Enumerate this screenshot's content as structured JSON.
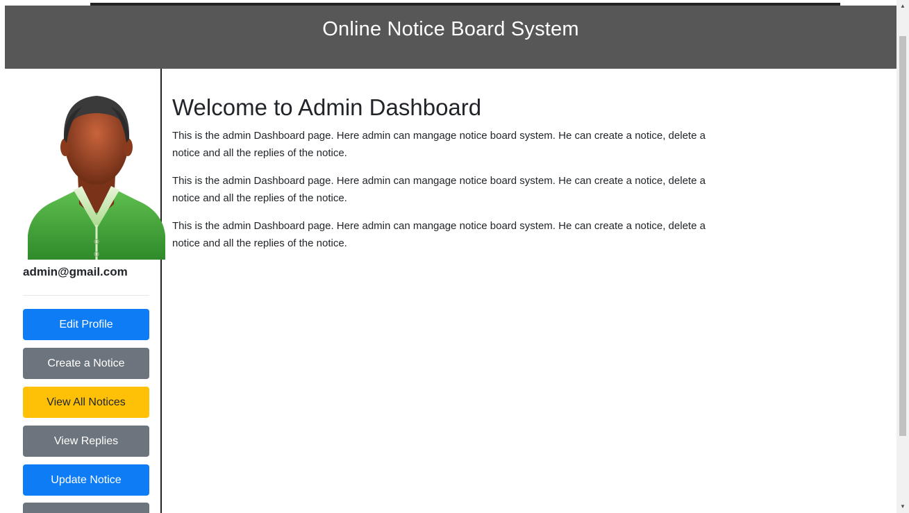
{
  "header": {
    "title": "Online Notice Board System"
  },
  "sidebar": {
    "avatar_icon": "admin-avatar-icon",
    "email": "admin@gmail.com",
    "buttons": [
      {
        "label": "Edit Profile",
        "style": "primary",
        "color": "#0d7cf5"
      },
      {
        "label": "Create a Notice",
        "style": "secondary",
        "color": "#6c757d"
      },
      {
        "label": "View All Notices",
        "style": "warning",
        "color": "#ffc107"
      },
      {
        "label": "View Replies",
        "style": "secondary",
        "color": "#6c757d"
      },
      {
        "label": "Update Notice",
        "style": "primary",
        "color": "#0d7cf5"
      },
      {
        "label": "",
        "style": "secondary",
        "color": "#6c757d"
      }
    ]
  },
  "main": {
    "heading": "Welcome to Admin Dashboard",
    "paragraphs": [
      "This is the admin Dashboard page. Here admin can mangage notice board system. He can create a notice, delete a notice and all the replies of the notice.",
      "This is the admin Dashboard page. Here admin can mangage notice board system. He can create a notice, delete a notice and all the replies of the notice.",
      "This is the admin Dashboard page. Here admin can mangage notice board system. He can create a notice, delete a notice and all the replies of the notice."
    ]
  },
  "colors": {
    "header_bg": "#575757",
    "header_text": "#ffffff",
    "primary": "#0d7cf5",
    "secondary": "#6c757d",
    "warning": "#ffc107"
  }
}
